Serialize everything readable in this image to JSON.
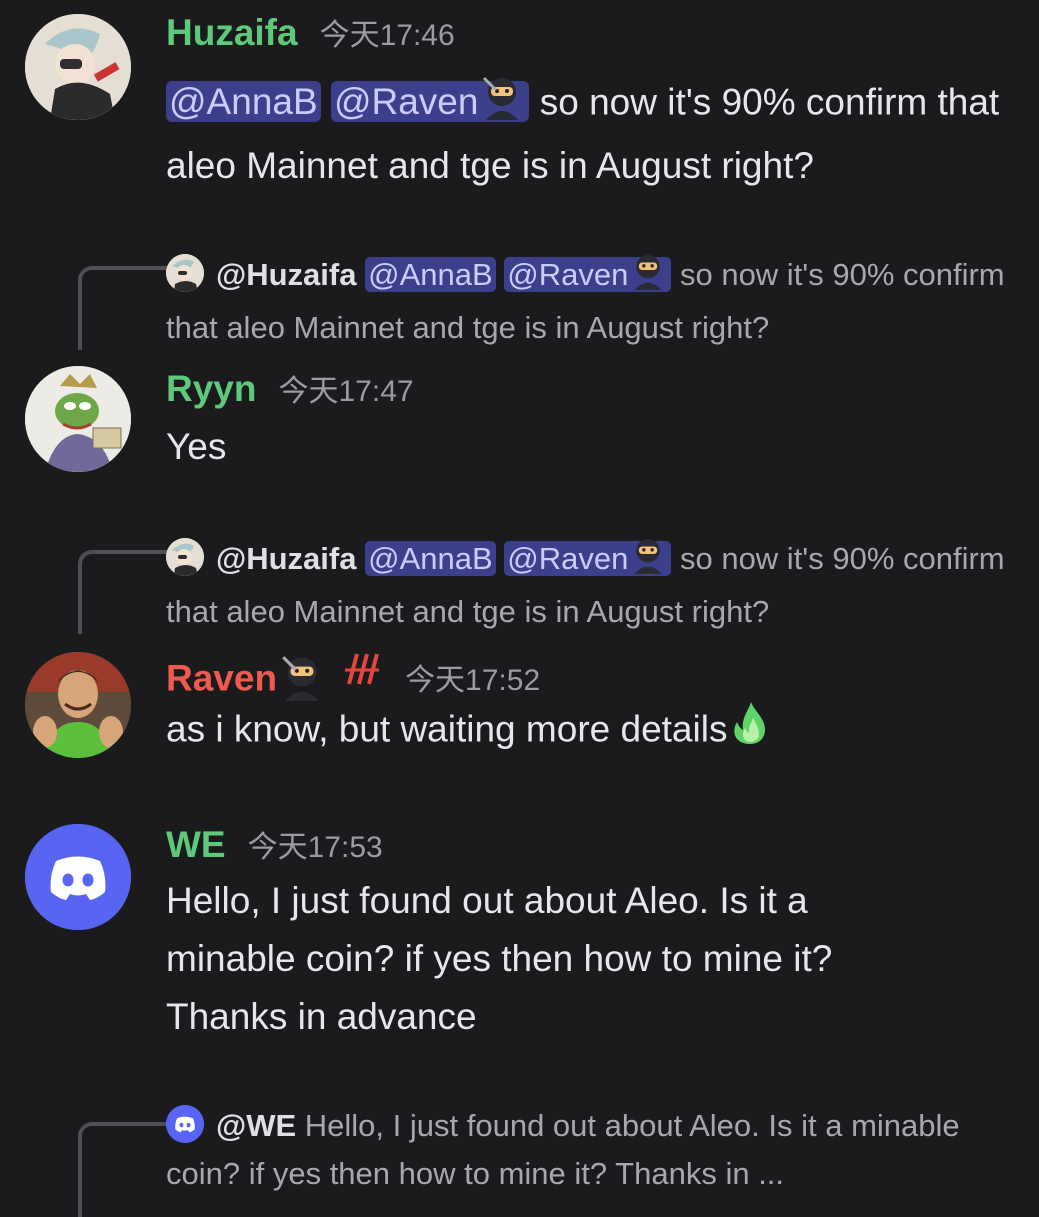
{
  "messages": [
    {
      "author": "Huzaifa",
      "author_color": "#5ec97a",
      "time": "今天17:46",
      "mentions": [
        "@AnnaB",
        "@Raven"
      ],
      "text": " so now it's 90% confirm that aleo Mainnet and tge is in August right?"
    },
    {
      "reply": {
        "author": "@Huzaifa",
        "mentions": [
          "@AnnaB",
          "@Raven"
        ],
        "text": " so now it's 90% confirm that aleo Mainnet and tge is in August right?"
      },
      "author": "Ryyn",
      "author_color": "#5ec97a",
      "time": "今天17:47",
      "text": "Yes"
    },
    {
      "reply": {
        "author": "@Huzaifa",
        "mentions": [
          "@AnnaB",
          "@Raven"
        ],
        "text": " so now it's 90% confirm that aleo Mainnet and tge is in August right?"
      },
      "author": "Raven",
      "author_color": "#ef5a4f",
      "time": "今天17:52",
      "text": "as i know, but waiting more details"
    },
    {
      "author": "WE",
      "author_color": "#5ec97a",
      "time": "今天17:53",
      "text": "Hello, I just found out about Aleo. Is it a minable coin? if yes then how to mine it? Thanks in advance",
      "avatar_color": "#5865f2"
    },
    {
      "reply": {
        "author": "@WE",
        "text": " Hello, I just found out about Aleo. Is it a minable coin? if yes then how to mine it? Thanks in ..."
      }
    }
  ]
}
